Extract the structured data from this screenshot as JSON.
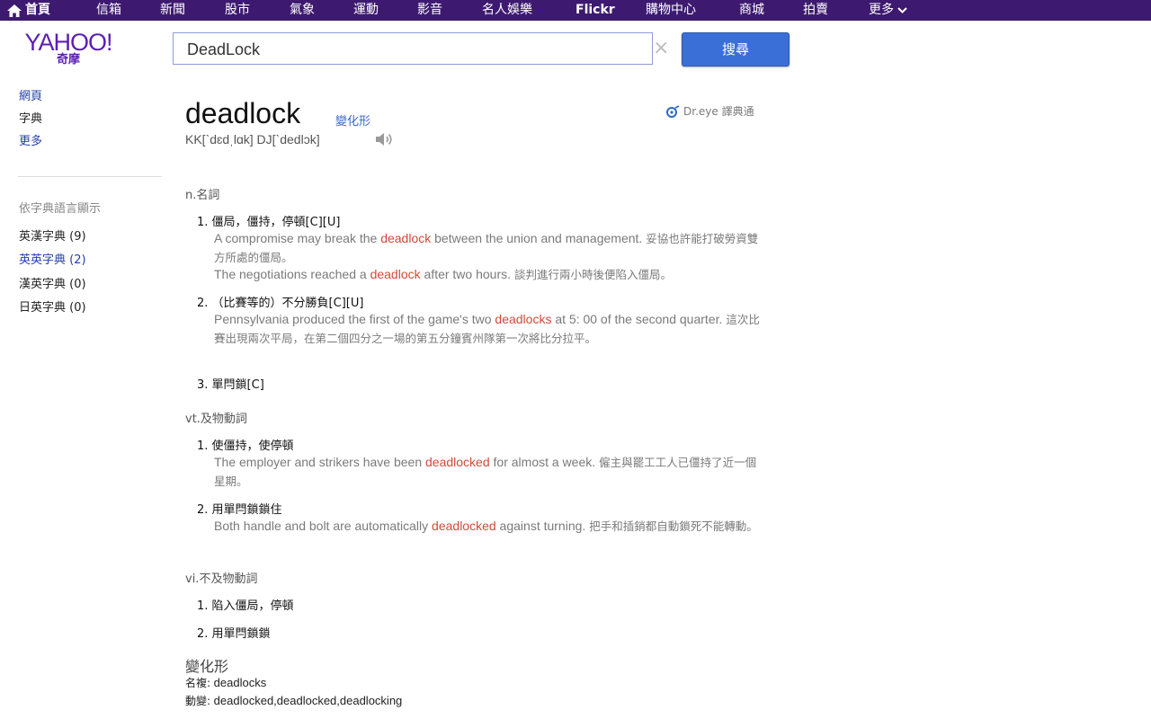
{
  "nav": {
    "home": "首頁",
    "items": [
      "信箱",
      "新聞",
      "股市",
      "氣象",
      "運動",
      "影音",
      "名人娛樂",
      "Flickr",
      "購物中心",
      "商城",
      "拍賣",
      "更多"
    ]
  },
  "logo": {
    "yahoo": "YAHOO!",
    "cn": "奇摩"
  },
  "search": {
    "value": "DeadLock",
    "button": "搜尋",
    "clear": "×"
  },
  "sidebar": {
    "links": [
      "網頁",
      "字典",
      "更多"
    ],
    "heading": "依字典語言顯示",
    "dicts": [
      "英漢字典 (9)",
      "英英字典 (2)",
      "漢英字典 (0)",
      "日英字典 (0)"
    ]
  },
  "entry": {
    "word": "deadlock",
    "variant_link": "變化形",
    "source": "Dr.eye 譯典通",
    "phonetic": "KK[ˋdɛdˌlɑk] DJ[ˋdedlɔk]",
    "sections": [
      {
        "pos": "n.名詞",
        "senses": [
          {
            "num": "1.",
            "def": "僵局，僵持，停頓[C][U]",
            "examples": [
              {
                "pre": "A compromise may break the ",
                "hl": "deadlock",
                "post": " between the union and management.",
                "cn": " 妥協也許能打破勞資雙方所處的僵局。"
              },
              {
                "pre": "The negotiations reached a ",
                "hl": "deadlock",
                "post": " after two hours.",
                "cn": " 談判進行兩小時後便陷入僵局。"
              }
            ]
          },
          {
            "num": "2.",
            "def": "（比賽等的）不分勝負[C][U]",
            "examples": [
              {
                "pre": "Pennsylvania produced the first of the game's two ",
                "hl": "deadlocks",
                "post": " at 5: 00 of the second quarter.",
                "cn": " 這次比賽出現兩次平局，在第二個四分之一場的第五分鐘賓州隊第一次將比分拉平。"
              }
            ]
          },
          {
            "num": "3.",
            "def": "單閂鎖[C]",
            "examples": []
          }
        ]
      },
      {
        "pos": "vt.及物動詞",
        "senses": [
          {
            "num": "1.",
            "def": "使僵持，使停頓",
            "examples": [
              {
                "pre": "The employer and strikers have been ",
                "hl": "deadlocked",
                "post": " for almost a week.",
                "cn": " 僱主與罷工工人已僵持了近一個星期。"
              }
            ]
          },
          {
            "num": "2.",
            "def": "用單閂鎖鎖住",
            "examples": [
              {
                "pre": "Both handle and bolt are automatically ",
                "hl": "deadlocked",
                "post": " against turning.",
                "cn": " 把手和插銷都自動鎖死不能轉動。"
              }
            ]
          }
        ]
      },
      {
        "pos": "vi.不及物動詞",
        "senses": [
          {
            "num": "1.",
            "def": "陷入僵局，停頓",
            "examples": []
          },
          {
            "num": "2.",
            "def": "用單閂鎖鎖",
            "examples": []
          }
        ]
      }
    ],
    "forms": {
      "title": "變化形",
      "plural_label": "名複:",
      "plural": "deadlocks",
      "verb_label": "動變:",
      "verb": "deadlocked,deadlocked,deadlocking"
    }
  },
  "colors": {
    "nav_bg": "#3d1a70",
    "brand": "#5c1fb3",
    "button": "#3b6fd8",
    "highlight": "#d24a38",
    "link": "#2440a8"
  }
}
